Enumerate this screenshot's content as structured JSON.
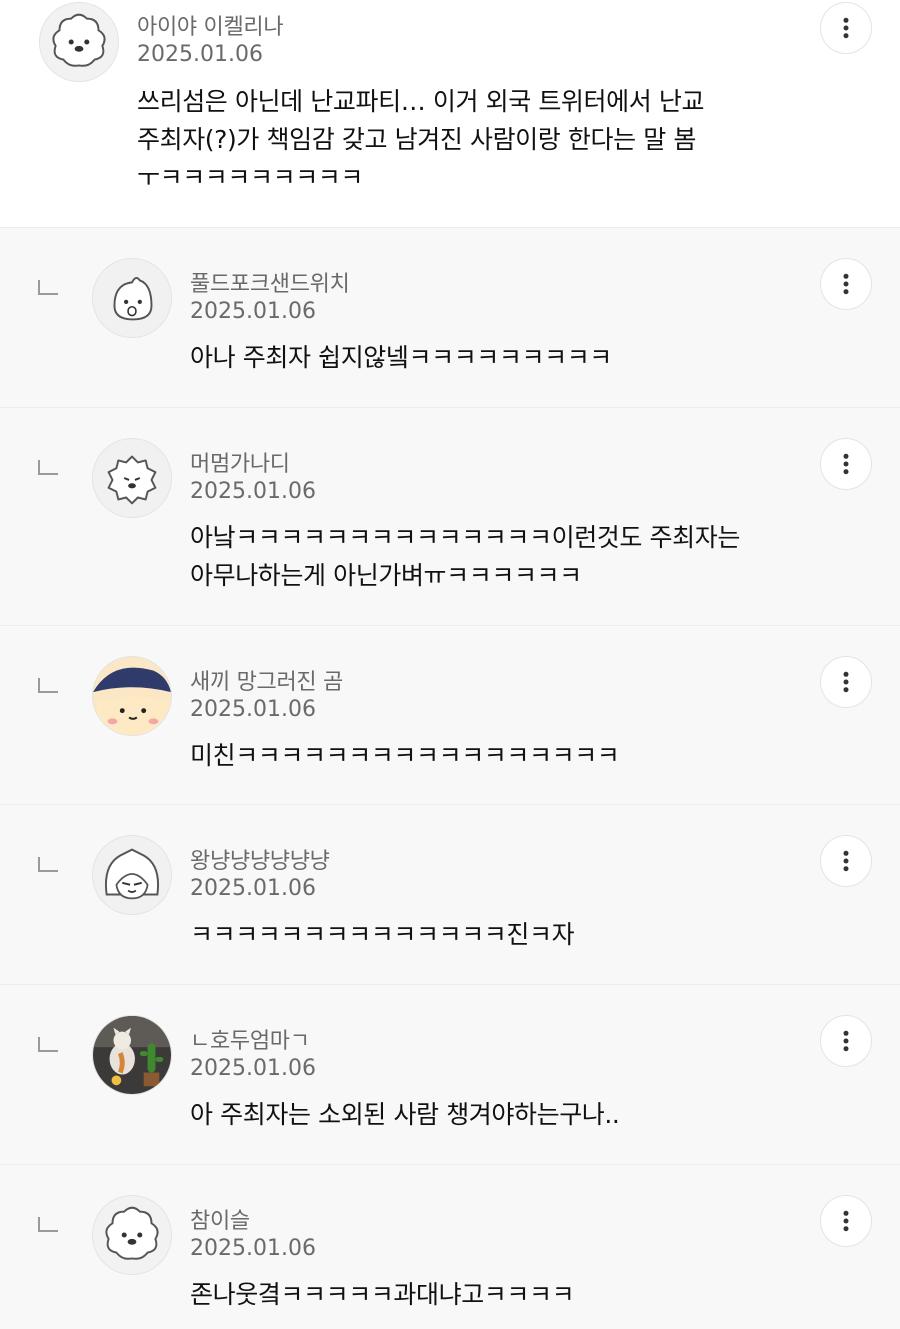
{
  "comments": [
    {
      "nickname": "아이야 이켈리나",
      "date": "2025.01.06",
      "lines": [
        "쓰리섬은 아닌데 난교파티… 이거 외국 트위터에서 난교",
        "주최자(?)가 책임감 갖고 남겨진 사람이랑 한다는 말 봄",
        "ㅜㅋㅋㅋㅋㅋㅋㅋㅋㅋ"
      ],
      "avatar": "poodle-avatar-icon",
      "reply": false
    },
    {
      "nickname": "풀드포크샌드위치",
      "date": "2025.01.06",
      "lines": [
        "아나 주최자 쉽지않넼ㅋㅋㅋㅋㅋㅋㅋㅋㅋ"
      ],
      "avatar": "peach-character-avatar-icon",
      "reply": true
    },
    {
      "nickname": "머멈가나디",
      "date": "2025.01.06",
      "lines": [
        "아낰ㅋㅋㅋㅋㅋㅋㅋㅋㅋㅋㅋㅋㅋㅋ이런것도 주최자는",
        "아무나하는게 아닌가벼ㅠㅋㅋㅋㅋㅋㅋ"
      ],
      "avatar": "lion-avatar-icon",
      "reply": true
    },
    {
      "nickname": "새끼 망그러진 곰",
      "date": "2025.01.06",
      "lines": [
        "미친ㅋㅋㅋㅋㅋㅋㅋㅋㅋㅋㅋㅋㅋㅋㅋㅋㅋ"
      ],
      "avatar": "sleepy-bear-avatar-icon",
      "reply": true
    },
    {
      "nickname": "왕냥냥냥냥냥냥",
      "date": "2025.01.06",
      "lines": [
        "ㅋㅋㅋㅋㅋㅋㅋㅋㅋㅋㅋㅋㅋㅋ진ㅋ자"
      ],
      "avatar": "hooded-cat-avatar-icon",
      "reply": true
    },
    {
      "nickname": "ㄴ호두엄마ㄱ",
      "date": "2025.01.06",
      "lines": [
        "아 주최자는 소외된 사람 챙겨야하는구나.."
      ],
      "avatar": "cat-photo-avatar-icon",
      "reply": true
    },
    {
      "nickname": "참이슬",
      "date": "2025.01.06",
      "lines": [
        "존나웃곀ㅋㅋㅋㅋㅋ과대냐고ㅋㅋㅋㅋ"
      ],
      "avatar": "poodle-avatar-icon",
      "reply": true
    }
  ],
  "more_icon": "more-vertical-icon",
  "colors": {
    "reply_bg": "#f8f8f9",
    "meta_text": "#6a6a6a",
    "body_text": "#111111",
    "separator": "#ececee"
  }
}
